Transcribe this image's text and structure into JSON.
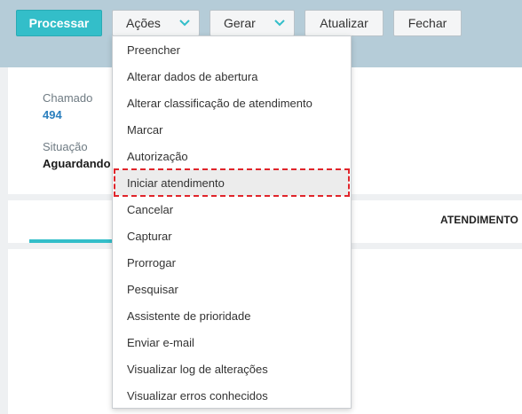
{
  "toolbar": {
    "processar": "Processar",
    "acoes": "Ações",
    "gerar": "Gerar",
    "atualizar": "Atualizar",
    "fechar": "Fechar",
    "icon": "chevron-down-icon"
  },
  "info": {
    "chamado_label": "Chamado",
    "chamado_value": "494",
    "situacao_label": "Situação",
    "situacao_value": "Aguardando a"
  },
  "tabs": {
    "active_tab": "ATENDIMENTO"
  },
  "menu": {
    "items": [
      "Preencher",
      "Alterar dados de abertura",
      "Alterar classificação de atendimento",
      "Marcar",
      "Autorização",
      "Iniciar atendimento",
      "Cancelar",
      "Capturar",
      "Prorrogar",
      "Pesquisar",
      "Assistente de prioridade",
      "Enviar e-mail",
      "Visualizar log de alterações",
      "Visualizar erros conhecidos"
    ],
    "highlighted_index": 5
  },
  "colors": {
    "primary": "#33bec9",
    "link": "#2b7fbe",
    "highlight_border": "#e0252b",
    "topbar": "#b5ccd8"
  }
}
